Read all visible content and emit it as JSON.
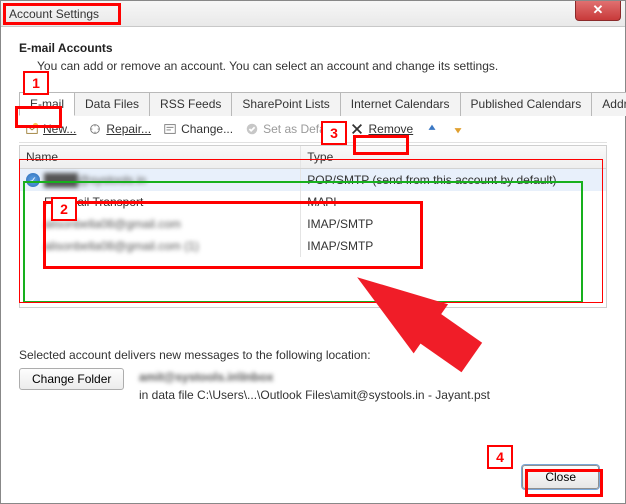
{
  "window": {
    "title": "Account Settings"
  },
  "header": {
    "heading": "E-mail Accounts",
    "subtext": "You can add or remove an account. You can select an account and change its settings."
  },
  "tabs": [
    {
      "label": "E-mail",
      "active": true
    },
    {
      "label": "Data Files"
    },
    {
      "label": "RSS Feeds"
    },
    {
      "label": "SharePoint Lists"
    },
    {
      "label": "Internet Calendars"
    },
    {
      "label": "Published Calendars"
    },
    {
      "label": "Address Books"
    }
  ],
  "toolbar": {
    "new": "New...",
    "repair": "Repair...",
    "change": "Change...",
    "set_default": "Set as Default",
    "remove": "Remove"
  },
  "columns": {
    "name": "Name",
    "type": "Type"
  },
  "accounts": [
    {
      "name": "████@systools.in",
      "type": "POP/SMTP (send from this account by default)",
      "default": true,
      "selected": true
    },
    {
      "name": "Fax Mail Transport",
      "type": "MAPI"
    },
    {
      "name": "alisonbella08@gmail.com",
      "type": "IMAP/SMTP"
    },
    {
      "name": "alisonbella08@gmail.com (1)",
      "type": "IMAP/SMTP"
    }
  ],
  "footer": {
    "selected_msg": "Selected account delivers new messages to the following location:",
    "change_folder": "Change Folder",
    "location_main": "amit@systools.in\\Inbox",
    "location_file": "in data file C:\\Users\\...\\Outlook Files\\amit@systools.in - Jayant.pst",
    "close": "Close"
  },
  "callouts": {
    "c1": "1",
    "c2": "2",
    "c3": "3",
    "c4": "4"
  }
}
